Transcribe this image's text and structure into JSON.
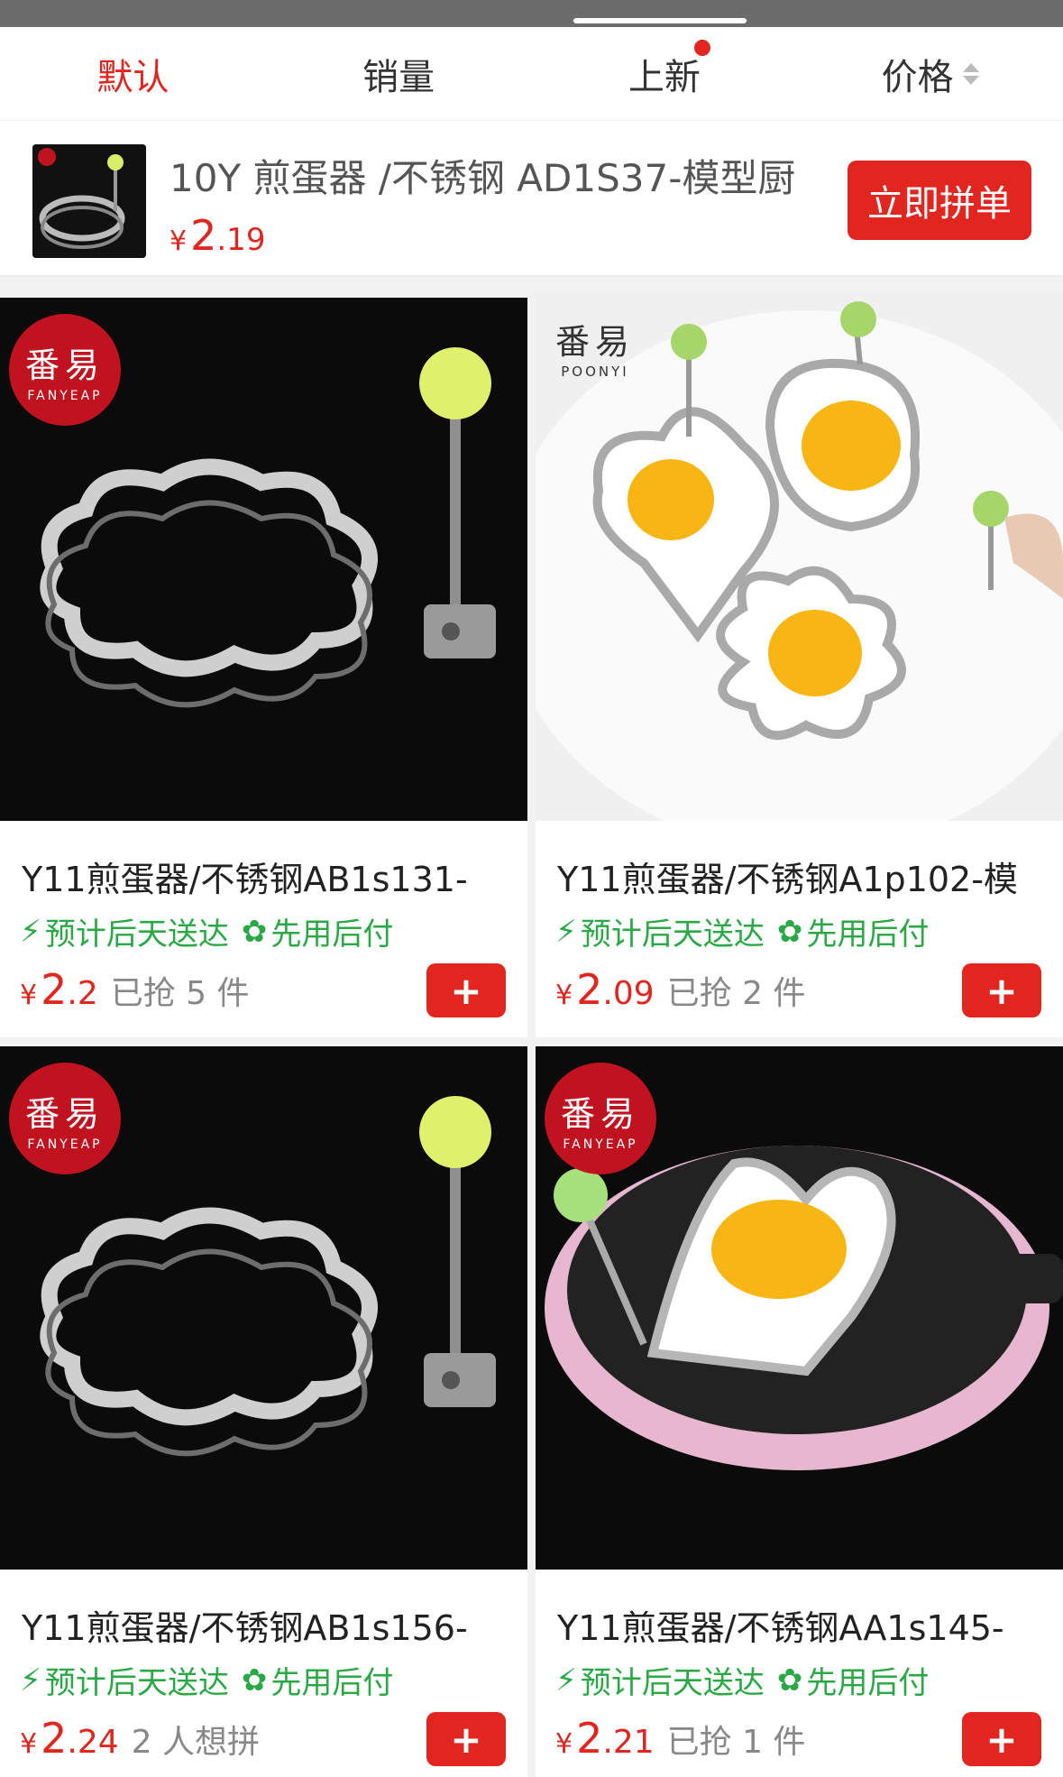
{
  "sort_tabs": [
    {
      "label": "默认",
      "active": true
    },
    {
      "label": "销量",
      "active": false
    },
    {
      "label": "上新",
      "active": false,
      "dot": true
    },
    {
      "label": "价格",
      "active": false,
      "sort_icon": "updown-arrows-icon"
    }
  ],
  "group_buy": {
    "title": "10Y 煎蛋器 /不锈钢 AD1S37-模型厨",
    "price_yen": "¥",
    "price_int": "2",
    "price_dec": ".19",
    "button_label": "立即拼单"
  },
  "products": [
    {
      "title": "Y11煎蛋器/不锈钢AB1s131-",
      "tag_delivery": "预计后天送达",
      "tag_pay": "先用后付",
      "price_yen": "¥",
      "price_int": "2",
      "price_dec": ".2",
      "sold": "已抢 5 件",
      "add_label": "+",
      "brand_cn": "番易",
      "brand_en": "FANYEAP"
    },
    {
      "title": "Y11煎蛋器/不锈钢A1p102-模",
      "tag_delivery": "预计后天送达",
      "tag_pay": "先用后付",
      "price_yen": "¥",
      "price_int": "2",
      "price_dec": ".09",
      "sold": "已抢 2 件",
      "add_label": "+",
      "brand_cn": "番易",
      "brand_en": "POONYI"
    },
    {
      "title": "Y11煎蛋器/不锈钢AB1s156-",
      "tag_delivery": "预计后天送达",
      "tag_pay": "先用后付",
      "price_yen": "¥",
      "price_int": "2",
      "price_dec": ".24",
      "sold": "2 人想拼",
      "add_label": "+",
      "brand_cn": "番易",
      "brand_en": "FANYEAP"
    },
    {
      "title": "Y11煎蛋器/不锈钢AA1s145-",
      "tag_delivery": "预计后天送达",
      "tag_pay": "先用后付",
      "price_yen": "¥",
      "price_int": "2",
      "price_dec": ".21",
      "sold": "已抢 1 件",
      "add_label": "+",
      "brand_cn": "番易",
      "brand_en": "FANYEAP"
    }
  ],
  "colors": {
    "accent": "#e0261f",
    "tag_green": "#2aa845"
  }
}
